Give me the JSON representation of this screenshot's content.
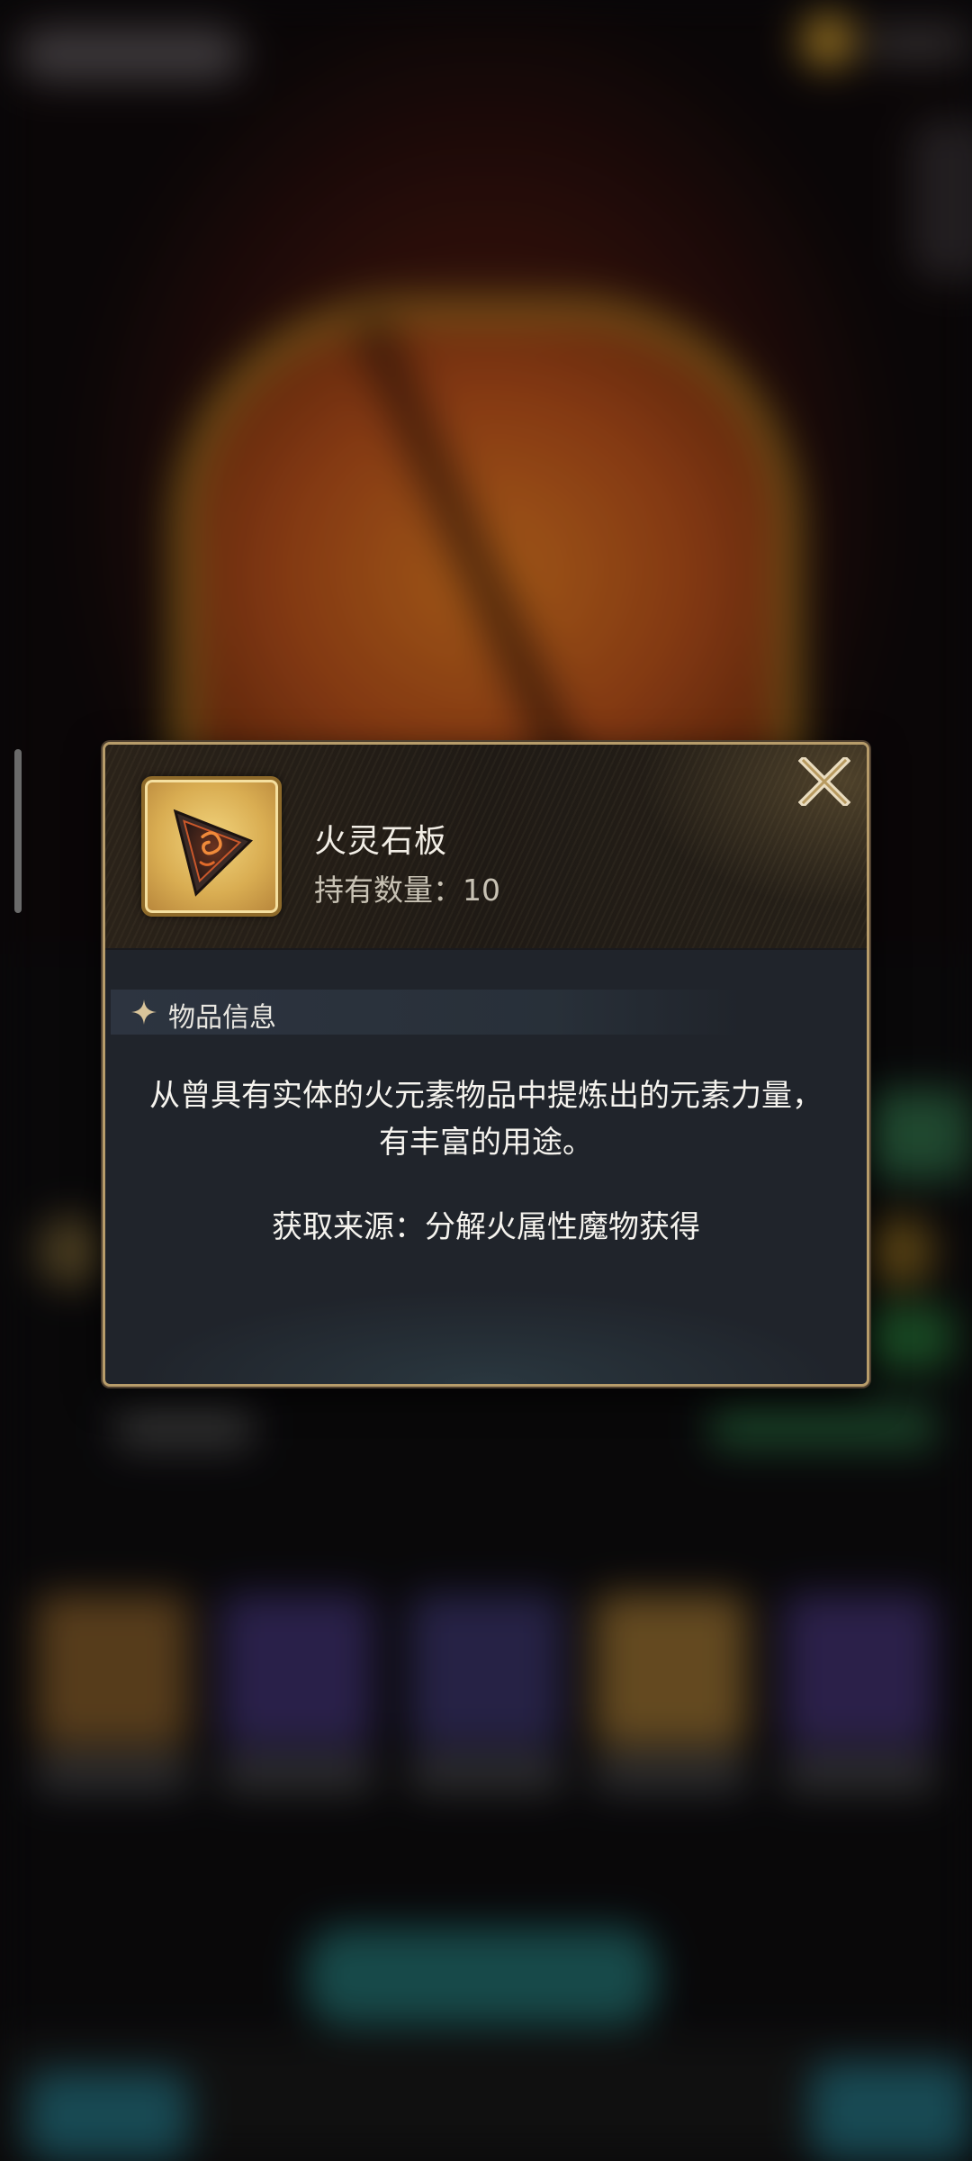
{
  "dialog": {
    "item_name": "火灵石板",
    "count_label": "持有数量：",
    "count_value": "10",
    "close_glyph": "X",
    "section_title": "物品信息",
    "description": "从曾具有实体的火元素物品中提炼出的元素力量，有丰富的用途。",
    "source_label": "获取来源：",
    "source_text": "分解火属性魔物获得"
  },
  "icons": {
    "item": "fire-spirit-slate-icon",
    "section": "sparkle-star-icon",
    "close": "close-icon"
  },
  "colors": {
    "dialog_border": "#b79c6a",
    "dialog_body": "#20242b",
    "item_frame": "#d9ad52",
    "text_primary": "#f5f3ee",
    "text_secondary": "#c8c2b4"
  }
}
